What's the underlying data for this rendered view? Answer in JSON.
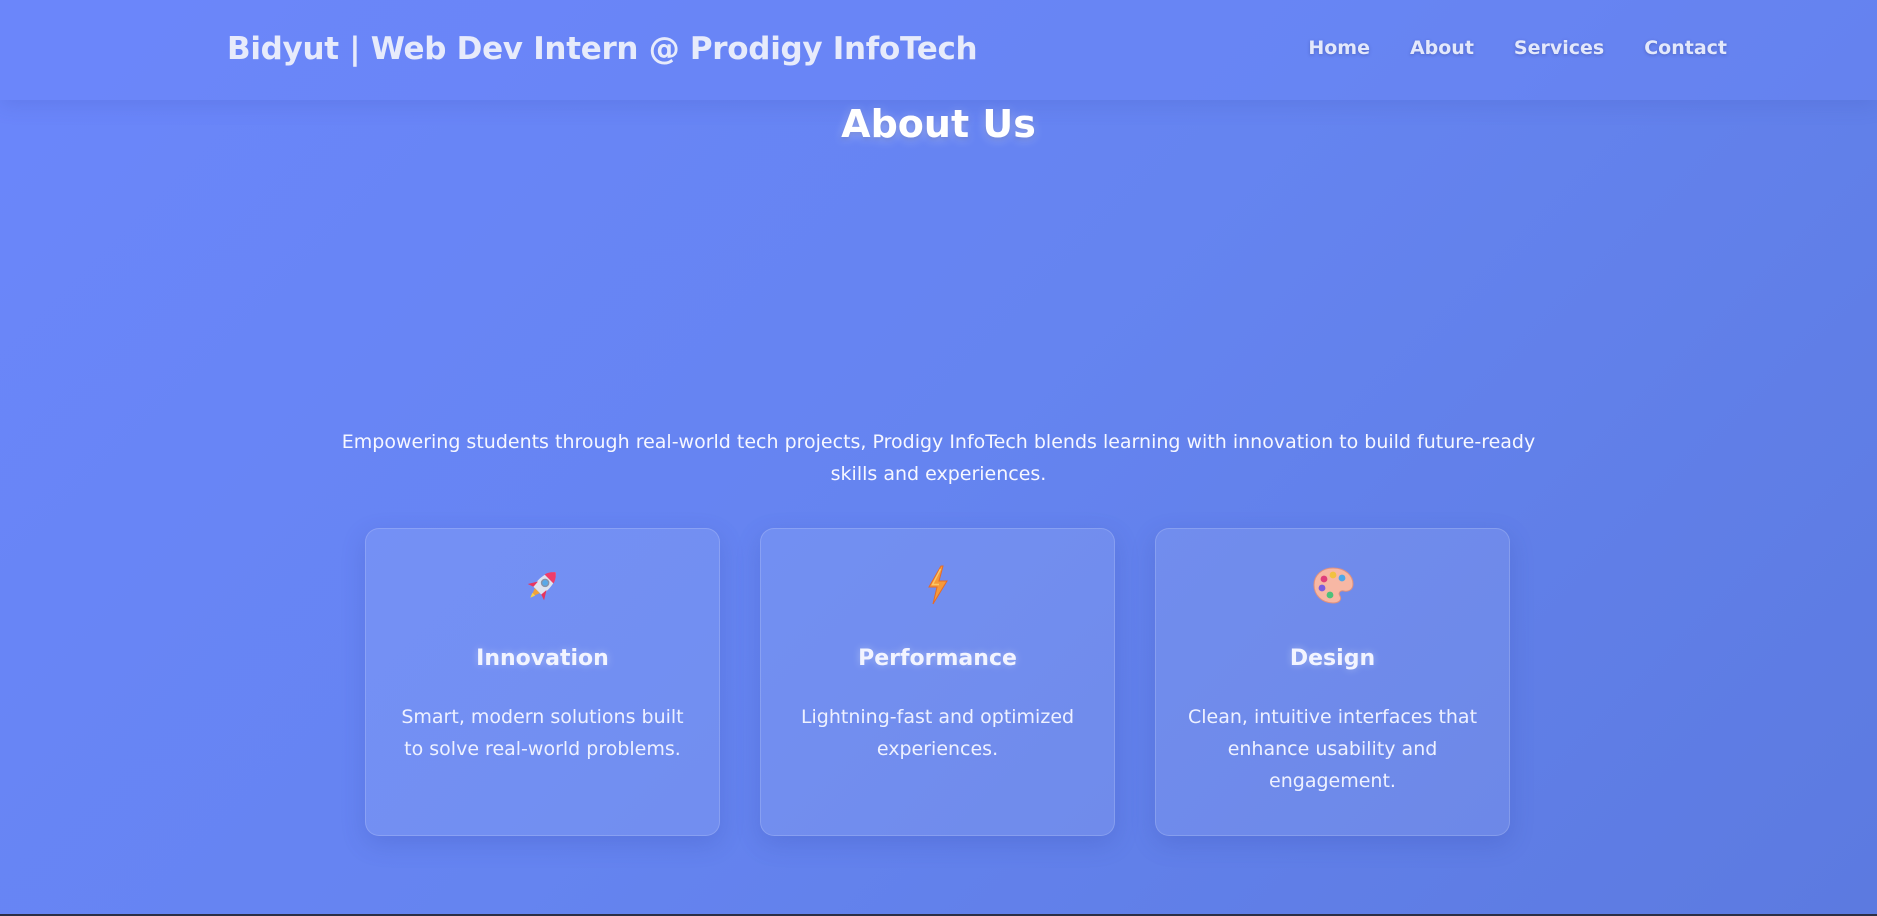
{
  "header": {
    "brand": "Bidyut | Web Dev Intern @ Prodigy InfoTech",
    "nav": [
      {
        "label": "Home"
      },
      {
        "label": "About"
      },
      {
        "label": "Services"
      },
      {
        "label": "Contact"
      }
    ]
  },
  "about": {
    "title": "About Us",
    "intro": "Empowering students through real-world tech projects, Prodigy InfoTech blends learning with innovation to build future-ready skills and experiences.",
    "cards": [
      {
        "icon": "rocket-icon",
        "title": "Innovation",
        "description": "Smart, modern solutions built to solve real-world problems."
      },
      {
        "icon": "lightning-icon",
        "title": "Performance",
        "description": "Lightning-fast and optimized experiences."
      },
      {
        "icon": "palette-icon",
        "title": "Design",
        "description": "Clean, intuitive interfaces that enhance usability and engagement."
      }
    ]
  },
  "colors": {
    "background_start": "#6b86fb",
    "background_end": "#5c7ae0",
    "text": "#ffffff"
  }
}
